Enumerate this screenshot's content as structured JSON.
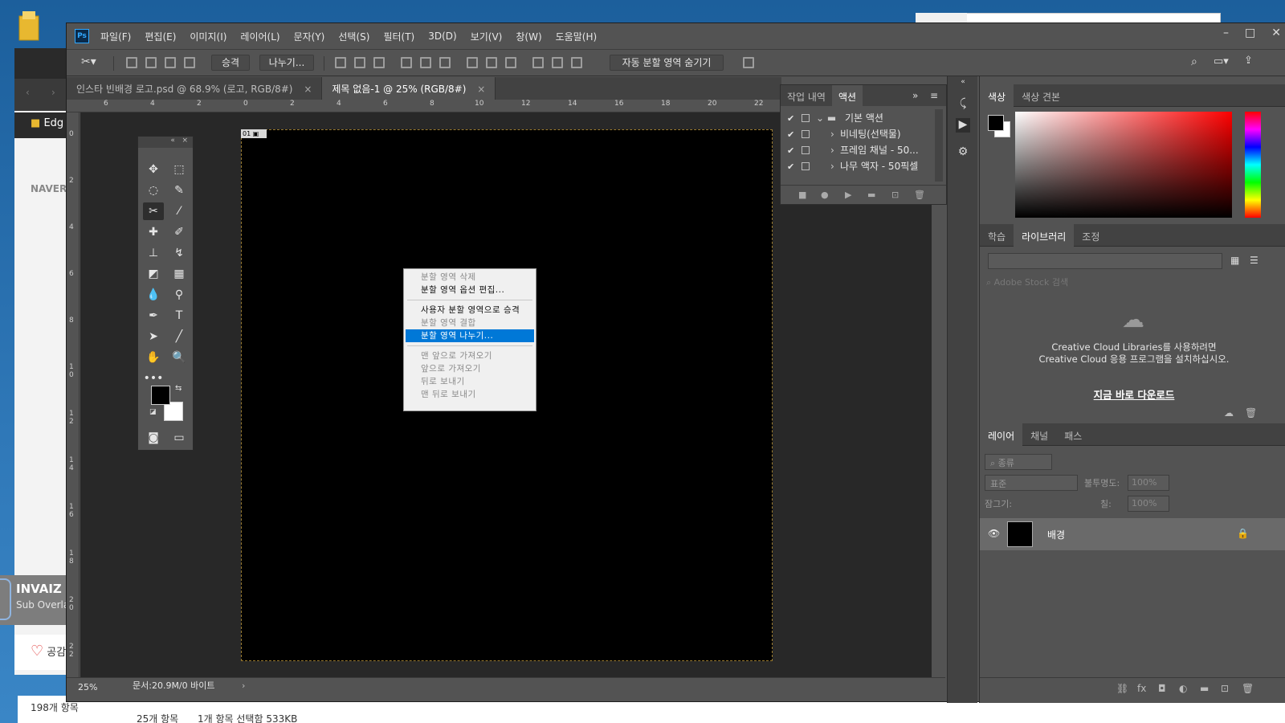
{
  "desktop": {
    "browser_fav_label": "Edg",
    "naver_label": "NAVER",
    "invaiz_title": "INVAIZ",
    "invaiz_sub": "Sub Overlay",
    "like_label": "공감",
    "explorer_count": "198개 항목",
    "explorer_items": "25개 항목",
    "explorer_selected": "1개 항목 선택함 533KB"
  },
  "menubar": {
    "logo": "Ps",
    "items": [
      "파일(F)",
      "편집(E)",
      "이미지(I)",
      "레이어(L)",
      "문자(Y)",
      "선택(S)",
      "필터(T)",
      "3D(D)",
      "보기(V)",
      "창(W)",
      "도움말(H)"
    ],
    "minimize": "–",
    "maximize": "□",
    "close": "✕"
  },
  "options": {
    "promote_label": "승격",
    "divide_label": "나누기...",
    "hide_auto_label": "자동 분할 영역 숨기기"
  },
  "tabs": [
    {
      "label": "인스타 빈배경 로고.psd @ 68.9% (로고, RGB/8#)",
      "close": "×"
    },
    {
      "label": "제목 없음-1 @ 25% (RGB/8#)",
      "close": "×"
    }
  ],
  "ruler_h": [
    "6",
    "4",
    "2",
    "0",
    "2",
    "4",
    "6",
    "8",
    "10",
    "12",
    "14",
    "16",
    "18",
    "20",
    "22"
  ],
  "ruler_v": [
    "0",
    "2",
    "4",
    "6",
    "8",
    "1 0",
    "1 2",
    "1 4",
    "1 6",
    "1 8",
    "2 0",
    "2 2"
  ],
  "slice_tag": "01",
  "context_menu": {
    "items": [
      {
        "label": "분할 영역 삭제",
        "state": "disabled"
      },
      {
        "label": "분할 영역 옵션 편집...",
        "state": "enabled"
      },
      {
        "label": "사용자 분할 영역으로 승격",
        "state": "enabled"
      },
      {
        "label": "분할 영역 결합",
        "state": "disabled"
      },
      {
        "label": "분할 영역 나누기...",
        "state": "highlighted"
      },
      {
        "label": "맨 앞으로 가져오기",
        "state": "disabled"
      },
      {
        "label": "앞으로 가져오기",
        "state": "disabled"
      },
      {
        "label": "뒤로 보내기",
        "state": "disabled"
      },
      {
        "label": "맨 뒤로 보내기",
        "state": "disabled"
      }
    ]
  },
  "status": {
    "zoom": "25%",
    "doc_size": "문서:20.9M/0 바이트",
    "arrow": "›"
  },
  "actions_panel": {
    "tab_history": "작업 내역",
    "tab_actions": "액션",
    "expand": "»",
    "rows": [
      {
        "check": "✔",
        "label": "기본 액션"
      },
      {
        "check": "✔",
        "label": "비네팅(선택물)"
      },
      {
        "check": "✔",
        "label": "프레임 채널 - 50..."
      },
      {
        "check": "✔",
        "label": "나무 액자 - 50픽셀"
      }
    ],
    "footer_icons": [
      "■",
      "●",
      "▶",
      "▬",
      "⊡",
      "🗑"
    ]
  },
  "color_panel": {
    "tab_color": "색상",
    "tab_swatches": "색상 견본"
  },
  "library_panel": {
    "tab_learn": "학습",
    "tab_library": "라이브러리",
    "tab_adjust": "조정",
    "search_placeholder": "Adobe Stock 검색",
    "cc_message": "Creative Cloud Libraries를 사용하려면 Creative Cloud 응용 프로그램을 설치하십시오.",
    "download_link": "지금 바로 다운로드"
  },
  "layers_panel": {
    "tab_layers": "레이어",
    "tab_channels": "채널",
    "tab_paths": "패스",
    "filter_kind": "종류",
    "blend_mode": "표준",
    "opacity_label": "불투명도:",
    "opacity_value": "100%",
    "lock_label": "잠그기:",
    "fill_label": "칠:",
    "fill_value": "100%",
    "layer_name": "배경"
  },
  "colors": {
    "accent_highlight": "#0078d7",
    "ps_panel": "#535353",
    "ps_dark": "#424242",
    "canvas_bg": "#282828"
  }
}
